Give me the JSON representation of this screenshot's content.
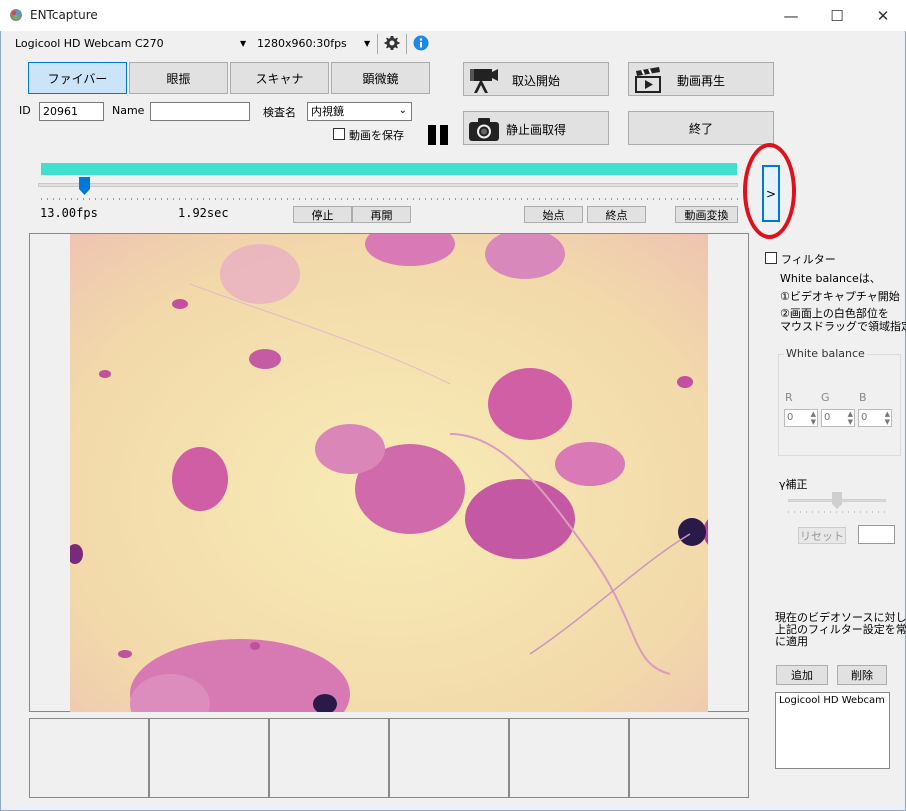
{
  "window": {
    "title": "ENTcapture",
    "minimize": "—",
    "maximize": "☐",
    "close": "✕"
  },
  "toolbar": {
    "camera": "Logicool HD Webcam C270",
    "resolution": "1280x960:30fps",
    "settings_icon": "gear-icon",
    "info_icon": "info-icon"
  },
  "modes": [
    "ファイバー",
    "眼振",
    "スキャナ",
    "顕微鏡"
  ],
  "form": {
    "id_label": "ID",
    "id_value": "20961",
    "name_label": "Name",
    "name_value": "",
    "exam_label": "検査名",
    "exam_value": "内視鏡",
    "save_video_label": "動画を保存"
  },
  "actions": {
    "capture_start": "取込開始",
    "video_play": "動画再生",
    "still_capture": "静止画取得",
    "quit": "終了",
    "expand": ">"
  },
  "playback": {
    "fps": "13.00fps",
    "time": "1.92sec",
    "stop": "停止",
    "resume": "再開",
    "start_point": "始点",
    "end_point": "終点",
    "convert": "動画変換",
    "progress": 1.0,
    "slider_position": 0.065
  },
  "filter": {
    "checkbox_label": "フィルター",
    "note1": "White balanceは、",
    "note2": "①ビデオキャプチャ開始",
    "note3a": "②画面上の白色部位を",
    "note3b": "マウスドラッグで領域指定",
    "wb_title": "White balance",
    "r_label": "R",
    "g_label": "G",
    "b_label": "B",
    "r_value": "0",
    "g_value": "0",
    "b_value": "0",
    "gamma_label": "γ補正",
    "gamma_position": 0.5,
    "reset": "リセット",
    "gamma_value": "",
    "apply_note1": "現在のビデオソースに対し、",
    "apply_note2": "上記のフィルター設定を常",
    "apply_note3": "に適用",
    "add": "追加",
    "delete": "削除",
    "sources": [
      "Logicool HD Webcam"
    ]
  },
  "colors": {
    "progress": "#40e0d0",
    "accent": "#0078d7",
    "highlight_ring": "#e0101a",
    "specimen_bg": "#f5e6a8"
  }
}
